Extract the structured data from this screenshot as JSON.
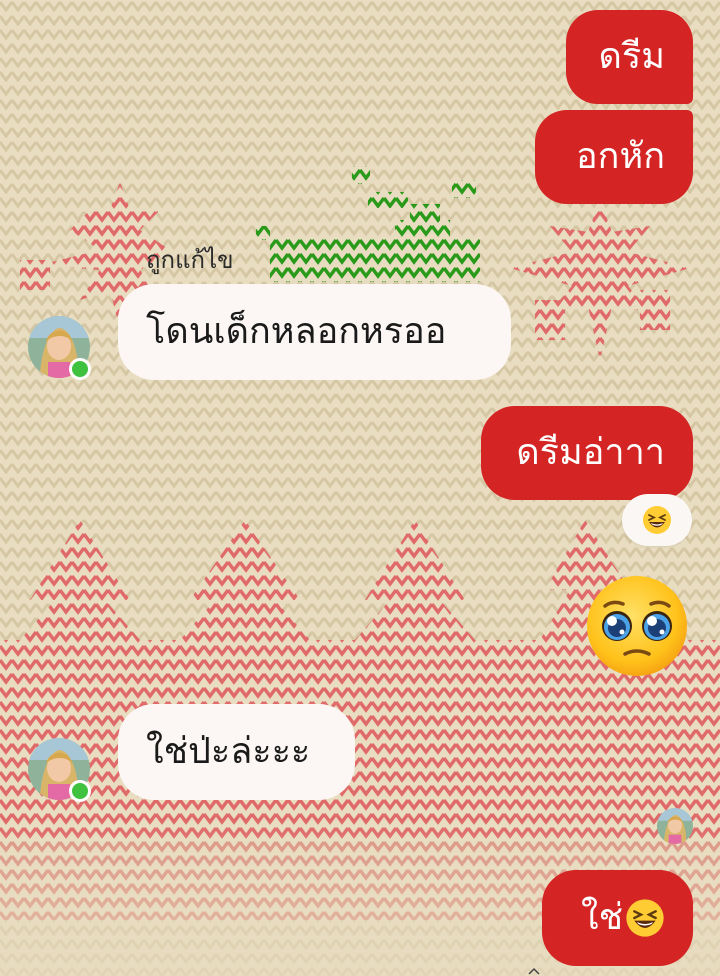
{
  "messages": [
    {
      "id": "m1",
      "side": "out",
      "text": "ดรีม"
    },
    {
      "id": "m2",
      "side": "out",
      "text": "อกหัก"
    },
    {
      "id": "m3",
      "side": "in",
      "text": "โดนเด็กหลอกหรออ",
      "edited_label": "ถูกแก้ไข"
    },
    {
      "id": "m4",
      "side": "out",
      "text": "ดรีมอ่าาา",
      "reaction": "grinning-squinting-face"
    },
    {
      "id": "m5",
      "side": "out",
      "sticker": "pleading-face-emoji"
    },
    {
      "id": "m6",
      "side": "in",
      "text": "ใช่ป่ะล่ะะะ"
    },
    {
      "id": "m7",
      "side": "out",
      "text": "ใช่",
      "trailing_emoji": "grinning-squinting-face"
    }
  ],
  "colors": {
    "outgoing_bubble": "#d42424",
    "incoming_bubble": "#fcf6f4",
    "background": "#e8dcc0",
    "knit_red": "#e06a6a",
    "knit_green": "#2a9a1a",
    "online": "#3fc23f"
  }
}
